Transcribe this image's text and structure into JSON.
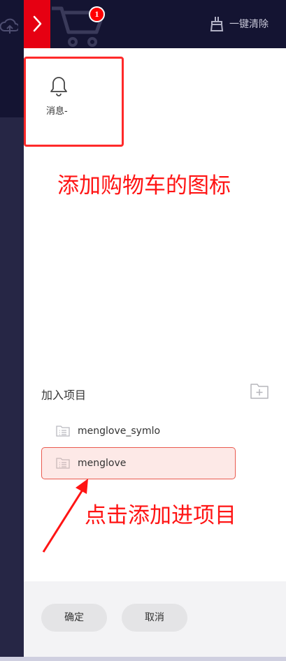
{
  "cart": {
    "badge_count": "1"
  },
  "header": {
    "clear_label": "一键清除"
  },
  "messages": {
    "label": "消息-"
  },
  "annotations": {
    "cart_note": "添加购物车的图标",
    "project_note": "点击添加进项目"
  },
  "projects": {
    "title": "加入项目",
    "items": [
      {
        "name": "menglove_symlo",
        "selected": false
      },
      {
        "name": "menglove",
        "selected": true
      }
    ]
  },
  "footer": {
    "confirm_label": "确定",
    "cancel_label": "取消"
  },
  "colors": {
    "accent": "#e60012",
    "header_bg": "#141432",
    "annotation": "#ff1414"
  }
}
